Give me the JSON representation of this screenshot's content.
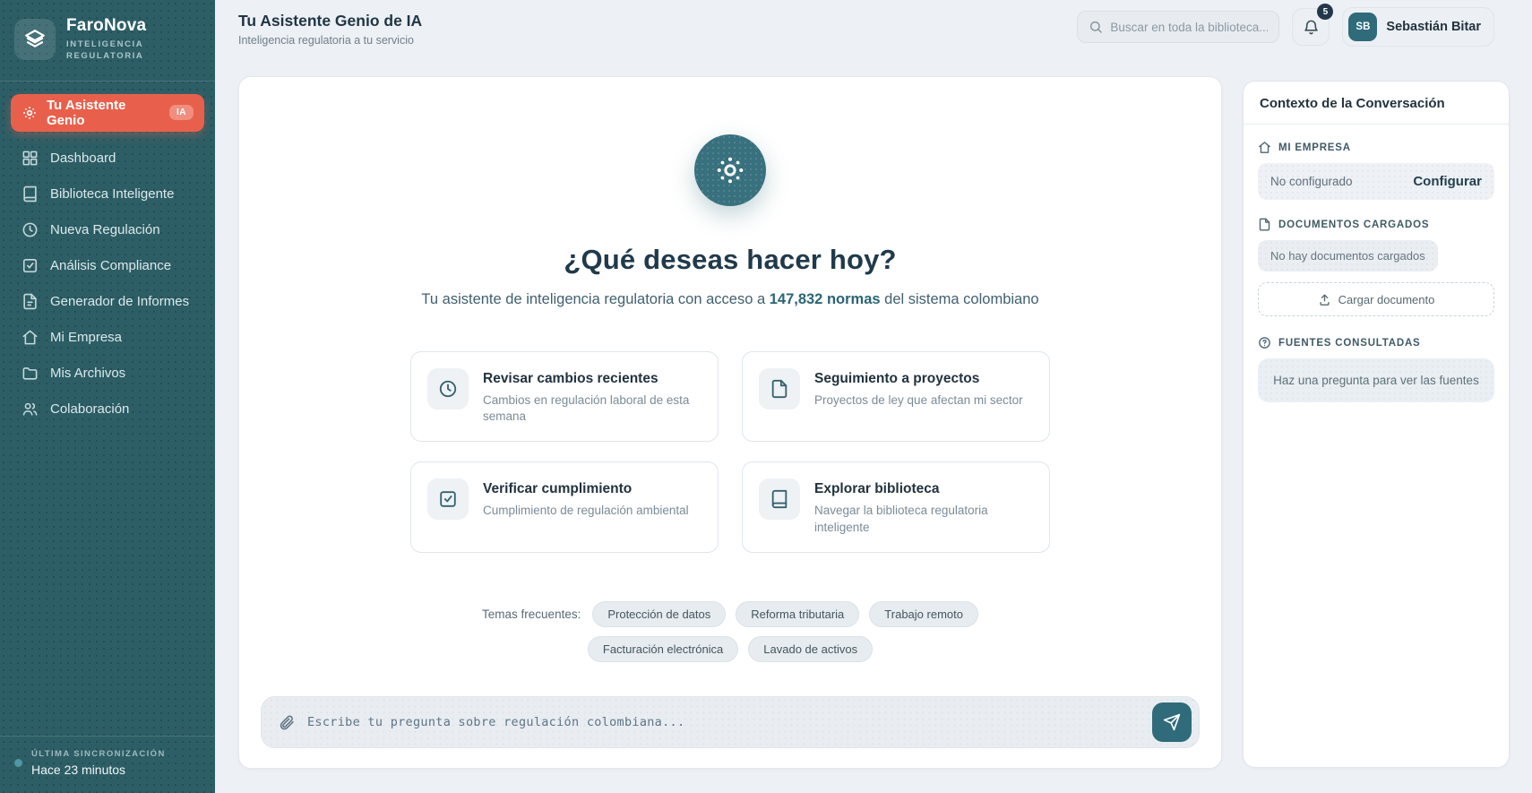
{
  "colors": {
    "sidebar": "#2d5e66",
    "accent_red": "#e8604c",
    "accent_teal": "#2f6b7a",
    "page_bg": "#edf0f4"
  },
  "brand": {
    "name": "FaroNova",
    "tagline_line1": "INTELIGENCIA",
    "tagline_line2": "REGULATORIA"
  },
  "sidebar": {
    "active_item": {
      "label": "Tu Asistente Genio",
      "badge": "IA"
    },
    "items": [
      {
        "label": "Dashboard",
        "icon": "grid-icon"
      },
      {
        "label": "Biblioteca Inteligente",
        "icon": "book-icon"
      },
      {
        "label": "Nueva Regulación",
        "icon": "clock-icon"
      },
      {
        "label": "Análisis Compliance",
        "icon": "check-square-icon"
      },
      {
        "label": "Generador de Informes",
        "icon": "file-text-icon"
      },
      {
        "label": "Mi Empresa",
        "icon": "home-icon"
      },
      {
        "label": "Mis Archivos",
        "icon": "folder-icon"
      },
      {
        "label": "Colaboración",
        "icon": "users-icon"
      }
    ],
    "sync": {
      "label": "ÚLTIMA SINCRONIZACIÓN",
      "value": "Hace 23 minutos"
    }
  },
  "header": {
    "title": "Tu Asistente Genio de IA",
    "subtitle": "Inteligencia regulatoria a tu servicio",
    "search_placeholder": "Buscar en toda la biblioteca...",
    "notifications_count": "5",
    "user": {
      "initials": "SB",
      "name": "Sebastián Bitar"
    }
  },
  "main": {
    "headline": "¿Qué deseas hacer hoy?",
    "subtitle_prefix": "Tu asistente de inteligencia regulatoria con acceso a ",
    "subtitle_highlight": "147,832 normas",
    "subtitle_suffix": " del sistema colombiano",
    "cards": [
      {
        "title": "Revisar cambios recientes",
        "description": "Cambios en regulación laboral de esta semana",
        "icon": "clock-icon"
      },
      {
        "title": "Seguimiento a proyectos",
        "description": "Proyectos de ley que afectan mi sector",
        "icon": "file-icon"
      },
      {
        "title": "Verificar cumplimiento",
        "description": "Cumplimiento de regulación ambiental",
        "icon": "check-square-icon"
      },
      {
        "title": "Explorar biblioteca",
        "description": "Navegar la biblioteca regulatoria inteligente",
        "icon": "book-icon"
      }
    ],
    "topics_label": "Temas frecuentes:",
    "topics": [
      "Protección de datos",
      "Reforma tributaria",
      "Trabajo remoto",
      "Facturación electrónica",
      "Lavado de activos"
    ],
    "input_placeholder": "Escribe tu pregunta sobre regulación colombiana..."
  },
  "context_panel": {
    "title": "Contexto de la Conversación",
    "company": {
      "heading": "MI EMPRESA",
      "status": "No configurado",
      "action": "Configurar"
    },
    "documents": {
      "heading": "DOCUMENTOS CARGADOS",
      "empty": "No hay documentos cargados",
      "upload_label": "Cargar documento"
    },
    "sources": {
      "heading": "FUENTES CONSULTADAS",
      "empty": "Haz una pregunta para ver las fuentes"
    }
  }
}
